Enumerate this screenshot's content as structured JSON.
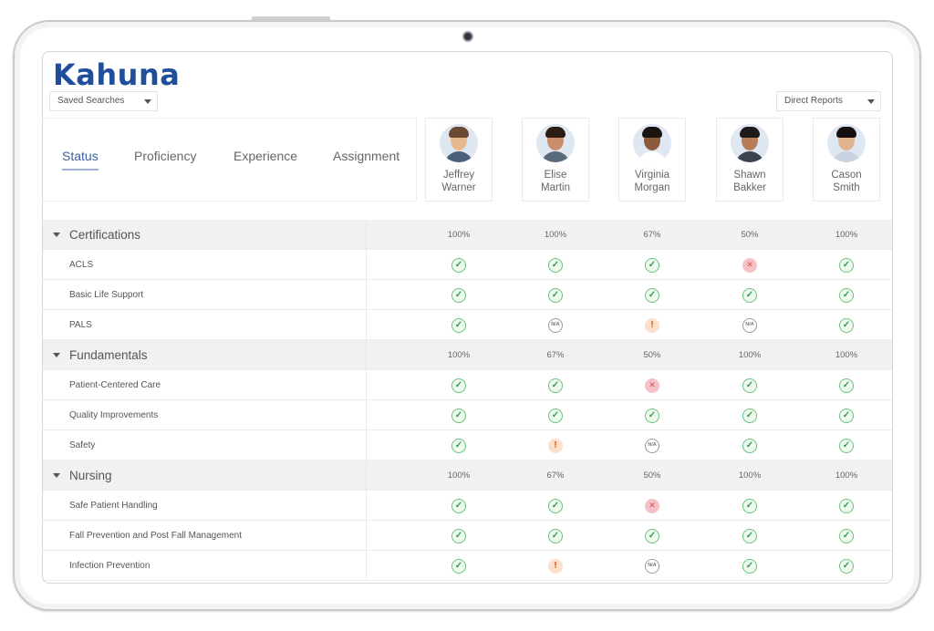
{
  "app": {
    "logo": "Kahuna"
  },
  "filters": {
    "saved_searches": "Saved Searches",
    "direct_reports": "Direct Reports"
  },
  "tabs": [
    {
      "label": "Status",
      "active": true
    },
    {
      "label": "Proficiency",
      "active": false
    },
    {
      "label": "Experience",
      "active": false
    },
    {
      "label": "Assignment",
      "active": false
    }
  ],
  "people": [
    {
      "first": "Jeffrey",
      "last": "Warner"
    },
    {
      "first": "Elise",
      "last": "Martin"
    },
    {
      "first": "Virginia",
      "last": "Morgan"
    },
    {
      "first": "Shawn",
      "last": "Bakker"
    },
    {
      "first": "Cason",
      "last": "Smith"
    }
  ],
  "categories": [
    {
      "name": "Certifications",
      "percents": [
        "100%",
        "100%",
        "67%",
        "50%",
        "100%"
      ],
      "items": [
        {
          "name": "ACLS",
          "status": [
            "check",
            "check",
            "check",
            "cross",
            "check"
          ]
        },
        {
          "name": "Basic Life Support",
          "status": [
            "check",
            "check",
            "check",
            "check",
            "check"
          ]
        },
        {
          "name": "PALS",
          "status": [
            "check",
            "na",
            "warn",
            "na",
            "check"
          ]
        }
      ]
    },
    {
      "name": "Fundamentals",
      "percents": [
        "100%",
        "67%",
        "50%",
        "100%",
        "100%"
      ],
      "items": [
        {
          "name": "Patient-Centered Care",
          "status": [
            "check",
            "check",
            "cross",
            "check",
            "check"
          ]
        },
        {
          "name": "Quality Improvements",
          "status": [
            "check",
            "check",
            "check",
            "check",
            "check"
          ]
        },
        {
          "name": "Safety",
          "status": [
            "check",
            "warn",
            "na",
            "check",
            "check"
          ]
        }
      ]
    },
    {
      "name": "Nursing",
      "percents": [
        "100%",
        "67%",
        "50%",
        "100%",
        "100%"
      ],
      "items": [
        {
          "name": "Safe Patient Handling",
          "status": [
            "check",
            "check",
            "cross",
            "check",
            "check"
          ]
        },
        {
          "name": "Fall Prevention and Post Fall Management",
          "status": [
            "check",
            "check",
            "check",
            "check",
            "check"
          ]
        },
        {
          "name": "Infection Prevention",
          "status": [
            "check",
            "warn",
            "na",
            "check",
            "check"
          ]
        }
      ]
    }
  ],
  "status_icons": {
    "check": {
      "glyph": "✓",
      "name": "check-circle-icon"
    },
    "cross": {
      "glyph": "✕",
      "name": "x-circle-icon"
    },
    "warn": {
      "glyph": "!",
      "name": "warning-icon"
    },
    "na": {
      "glyph": "N/A",
      "name": "na-icon"
    }
  },
  "colors": {
    "brand": "#1f4e9c",
    "active_tab": "#3b5f9a",
    "check": "#6cc27a",
    "cross": "#f6c1c6",
    "warn": "#fde0cc"
  }
}
